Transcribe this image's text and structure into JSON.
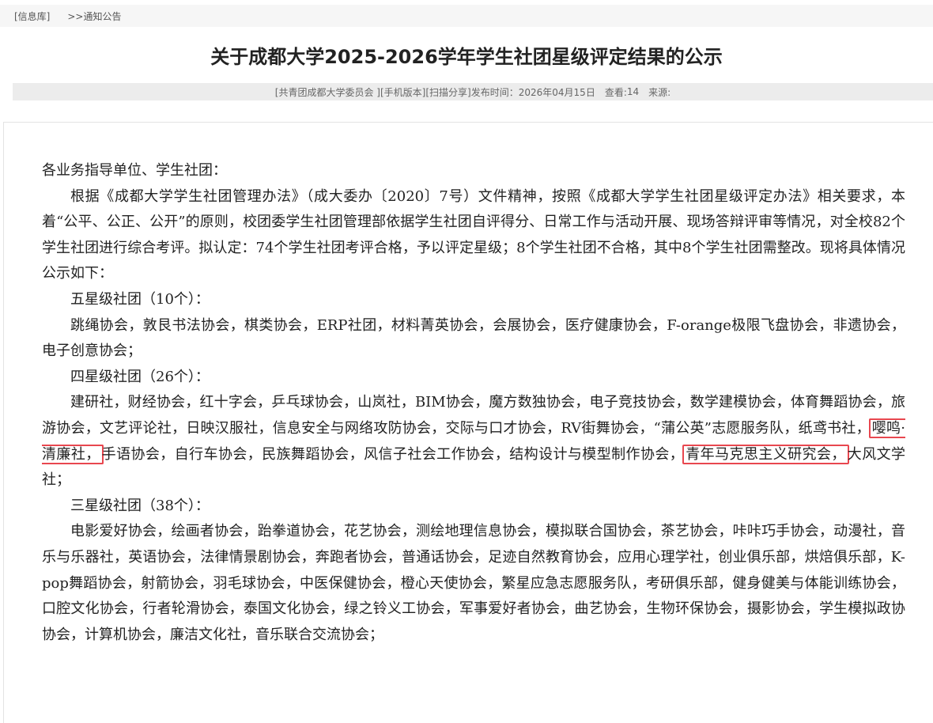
{
  "breadcrumb": {
    "library": "[信息库]",
    "current": ">>通知公告"
  },
  "title": "关于成都大学2025-2026学年学生社团星级评定结果的公示",
  "meta": {
    "publisher": "[共青团成都大学委员会 ]",
    "mobile": "[手机版本]",
    "scan_share": "[扫描分享]",
    "publish_label": "发布时间：",
    "publish_date": "2026年04月15日",
    "views_label": "查看:",
    "views": "14",
    "source_label": "来源:"
  },
  "article": {
    "greeting": "各业务指导单位、学生社团：",
    "intro": "根据《成都大学学生社团管理办法》（成大委办〔2020〕7号）文件精神，按照《成都大学学生社团星级评定办法》相关要求，本着“公平、公正、公开”的原则，校团委学生社团管理部依据学生社团自评得分、日常工作与活动开展、现场答辩评审等情况，对全校82个学生社团进行综合考评。拟认定：74个学生社团考评合格，予以评定星级；8个学生社团不合格，其中8个学生社团需整改。现将具体情况公示如下：",
    "five_star_heading": "五星级社团（10个）：",
    "five_star_list": "跳绳协会，敦艮书法协会，棋类协会，ERP社团，材料菁英协会，会展协会，医疗健康协会，F-orange极限飞盘协会，非遗协会，电子创意协会；",
    "four_star_heading": "四星级社团（26个）：",
    "four_star_part1": "建研社，财经协会，红十字会，乒乓球协会，山岚社，BIM协会，魔方数独协会，电子竞技协会，数学建模协会，体育舞蹈协会，旅游协会，文艺评论社，日映汉服社，信息安全与网络攻防协会，交际与口才协会，RV街舞协会，“蒲公英”志愿服务队，纸鸢书社，",
    "four_star_highlight1": "嘤鸣·清廉社，",
    "four_star_part2": "手语协会，自行车协会，民族舞蹈协会，风信子社会工作协会，结构设计与模型制作协会，",
    "four_star_highlight2": "青年马克思主义研究会，",
    "four_star_part3": "大风文学社；",
    "three_star_heading": "三星级社团（38个）：",
    "three_star_list": "电影爱好协会，绘画者协会，跆拳道协会，花艺协会，测绘地理信息协会，模拟联合国协会，茶艺协会，咔咔巧手协会，动漫社，音乐与乐器社，英语协会，法律情景剧协会，奔跑者协会，普通话协会，足迹自然教育协会，应用心理学社，创业俱乐部，烘焙俱乐部，K-pop舞蹈协会，射箭协会，羽毛球协会，中医保健协会，橙心天使协会，繁星应急志愿服务队，考研俱乐部，健身健美与体能训练协会，口腔文化协会，行者轮滑协会，泰国文化协会，绿之铃义工协会，军事爱好者协会，曲艺协会，生物环保协会，摄影协会，学生模拟政协协会，计算机协会，廉洁文化社，音乐联合交流协会；"
  },
  "colors": {
    "highlight_border": "#e8474f",
    "meta_bar": "#ececec",
    "breadcrumb_bar": "#f6f6f6"
  }
}
